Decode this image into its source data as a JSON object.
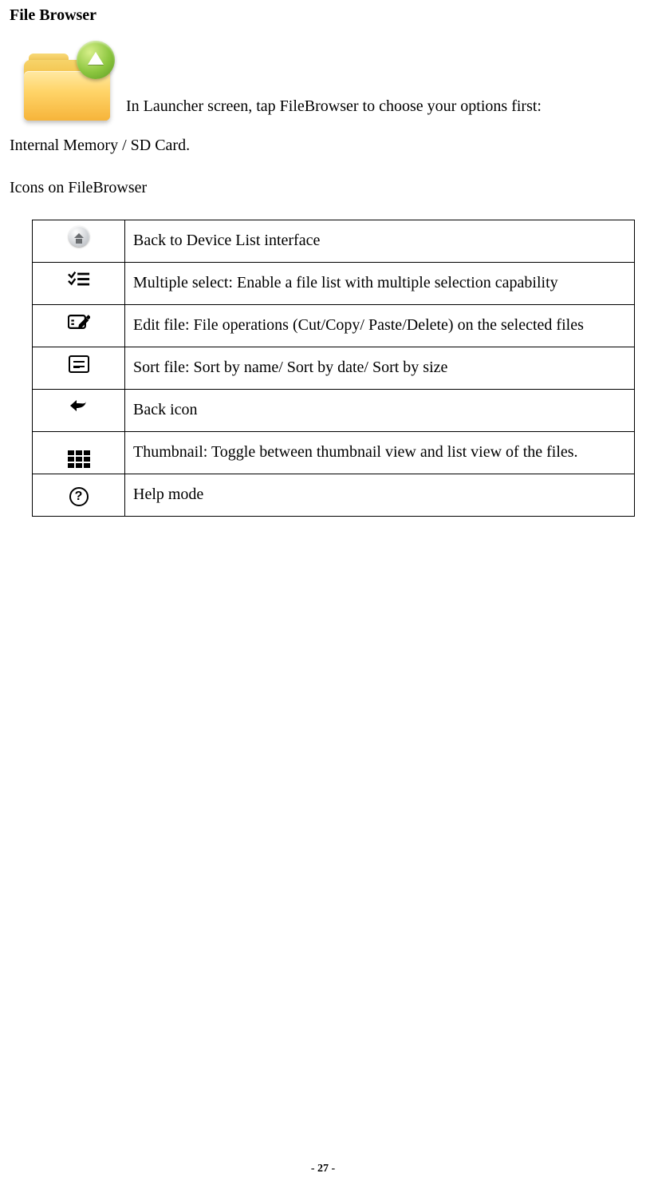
{
  "title": "File Browser",
  "intro_line1": "In Launcher screen, tap FileBrowser to choose your options first:",
  "intro_line2": "Internal Memory / SD Card.",
  "subheading": "Icons on FileBrowser",
  "rows": [
    {
      "icon": "home-icon",
      "desc": "Back to Device List interface"
    },
    {
      "icon": "multiselect-icon",
      "desc": "Multiple select: Enable a file list with multiple selection capability"
    },
    {
      "icon": "edit-file-icon",
      "desc": "Edit file: File operations (Cut/Copy/ Paste/Delete) on the selected files"
    },
    {
      "icon": "sort-file-icon",
      "desc": "Sort file: Sort by name/ Sort by date/ Sort by size"
    },
    {
      "icon": "back-icon",
      "desc": "Back icon"
    },
    {
      "icon": "thumbnail-icon",
      "desc": "Thumbnail:   Toggle between thumbnail view and list view of the files."
    },
    {
      "icon": "help-icon",
      "desc": "Help mode"
    }
  ],
  "page_number": "- 27 -"
}
